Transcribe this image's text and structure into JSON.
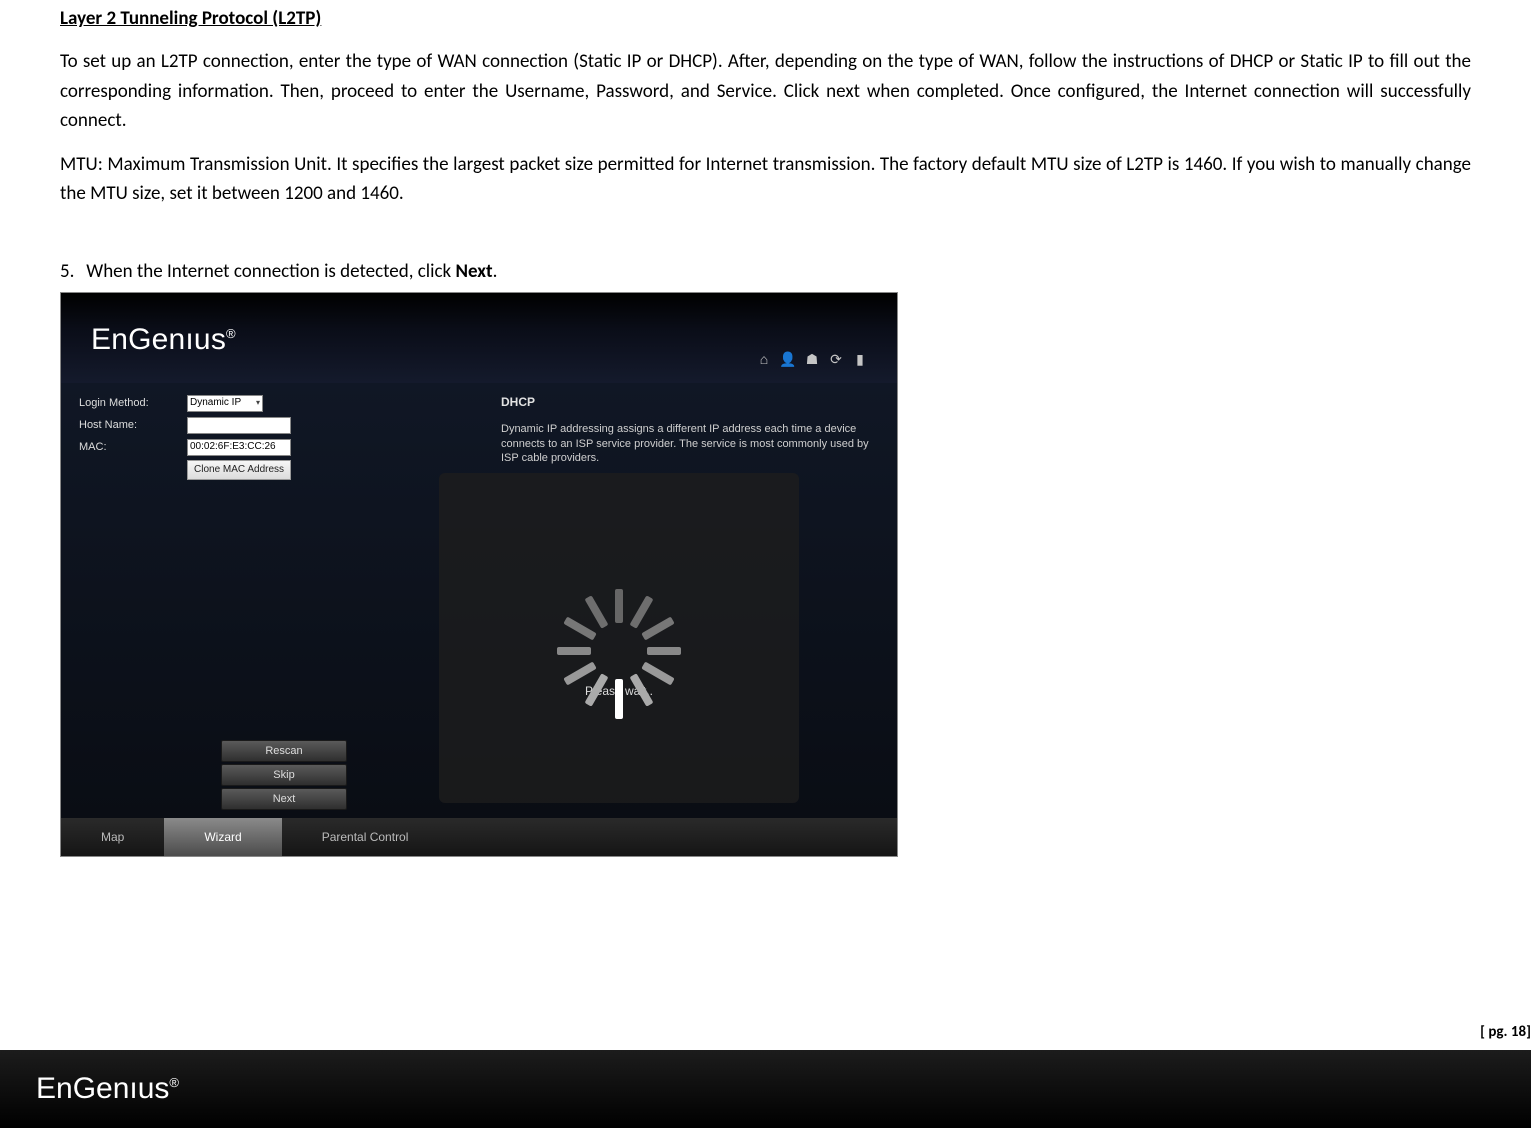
{
  "heading": "Layer 2 Tunneling Protocol (L2TP)",
  "para1": " To set up an L2TP connection, enter the type of WAN connection (Static IP or DHCP). After, depending on the type of WAN, follow the instructions of DHCP or Static IP to fill out the corresponding information. Then, proceed to enter the Username, Password, and Service. Click next when completed. Once configured, the Internet connection will successfully connect.",
  "para2": "MTU: Maximum Transmission Unit. It specifies the largest packet size permitted for Internet transmission. The factory default MTU size of L2TP is 1460. If you wish to manually change the MTU size, set it between 1200 and 1460.",
  "step_num": "5.",
  "step_text_pre": "When the Internet connection is detected, click ",
  "step_text_bold": "Next",
  "step_text_post": ".",
  "shot": {
    "logo": "EnGenıus",
    "logo_reg": "®",
    "form": {
      "login_label": "Login Method:",
      "login_value": "Dynamic IP",
      "host_label": "Host Name:",
      "host_value": "",
      "mac_label": "MAC:",
      "mac_value": "00:02:6F:E3:CC:26",
      "clone_btn": "Clone MAC Address"
    },
    "info": {
      "title": "DHCP",
      "text": "Dynamic IP addressing assigns a different IP address each time a device connects to an ISP service provider. The service is most commonly used by ISP cable providers."
    },
    "wait": "Please wait..",
    "buttons": {
      "rescan": "Rescan",
      "skip": "Skip",
      "next": "Next"
    },
    "tabs": {
      "map": "Map",
      "wizard": "Wizard",
      "parental": "Parental Control"
    }
  },
  "footer_logo": "EnGenıus",
  "footer_reg": "®",
  "page_num": "[ pg. 18]"
}
